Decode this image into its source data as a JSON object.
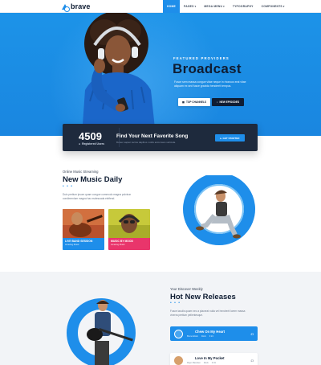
{
  "nav": {
    "logo": "brave",
    "items": [
      {
        "label": "HOME",
        "active": true,
        "has_caret": false
      },
      {
        "label": "PAGES",
        "active": false,
        "has_caret": true
      },
      {
        "label": "MEGA MENU",
        "active": false,
        "has_caret": true
      },
      {
        "label": "TYPOGRAPHY",
        "active": false,
        "has_caret": false
      },
      {
        "label": "COMPONENTS",
        "active": false,
        "has_caret": true
      }
    ]
  },
  "hero": {
    "overline": "FEATURED PROVIDERS",
    "title": "Broadcast",
    "text": "Fusce sem massa congue vitae neque in rhoncus erat vitae aliquam ex sed fusce gravida hendrerit tempus.",
    "btn_channels": "TOP CHANNELS",
    "btn_episodes": "NEW EPISODES"
  },
  "stats": {
    "number": "4509",
    "label": "Registered Users",
    "title": "Find Your Next Favorite Song",
    "text": "Donec sapien lectus dapibus mollis accumsan vehicula.",
    "button": "GET STARTED"
  },
  "music_daily": {
    "overline": "Online Music Streaming",
    "title": "New Music Daily",
    "dots": "• • •",
    "text": "Duis pretium ipsum quam congue commodo magna pulvinar condimentum magna hac malesuada eleifend.",
    "cards": [
      {
        "title": "LIVE BAND SESSION",
        "sub": "Amazing Music",
        "color": "#1e8eea"
      },
      {
        "title": "MUSIC BY MOOD",
        "sub": "Amazing Music",
        "color": "#e9356b"
      }
    ]
  },
  "releases": {
    "overline": "Your Discover Weekly",
    "title": "Hot New Releases",
    "dots": "• • •",
    "text": "Fusce iaculis quam nec a placerat nulla vel hendrerit lorem massa viverra pretium pellentesque.",
    "tracks": [
      {
        "title": "Chew On My Heart",
        "artist": "Bruno Elwin",
        "genre": "Rock",
        "duration": "3:24",
        "active": true
      },
      {
        "title": "Love In My Pocket",
        "artist": "Rayn Marsden",
        "genre": "Rock",
        "duration": "3:34",
        "active": false
      }
    ]
  },
  "colors": {
    "accent": "#1e8eea",
    "dark": "#0f1d33",
    "pink": "#e9356b"
  }
}
